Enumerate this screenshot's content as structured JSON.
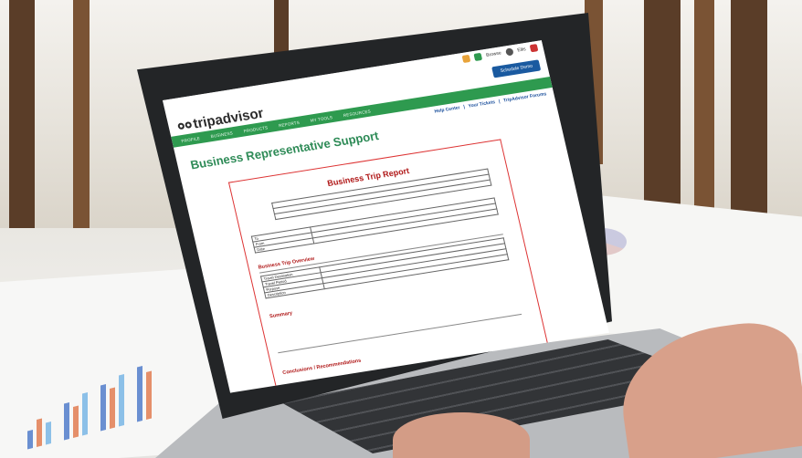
{
  "app": {
    "brand": "tripadvisor",
    "nav": [
      "PROFILE",
      "BUSINESS",
      "PRODUCTS",
      "REPORTS",
      "MY TOOLS",
      "RESOURCES"
    ],
    "account_menu": [
      "Browse",
      "Ellis"
    ],
    "schedule_button": "Schedule Demo",
    "subnav": [
      "Help Center",
      "Your Tickets",
      "TripAdvisor Forums"
    ],
    "page_title": "Business Representative Support"
  },
  "document": {
    "title": "Business Trip Report",
    "info_labels": [
      "To",
      "From",
      "Date"
    ],
    "overview_heading": "Business Trip Overview",
    "overview_labels": [
      "Travel Destination",
      "Travel Period",
      "Purpose",
      "Description"
    ],
    "summary_heading": "Summary",
    "conclusions_heading": "Conclusions / Recommendations"
  },
  "colors": {
    "brand_green": "#2e9a4f",
    "title_green": "#2e8b57",
    "report_red": "#b01818",
    "button_blue": "#1a5aa0"
  }
}
